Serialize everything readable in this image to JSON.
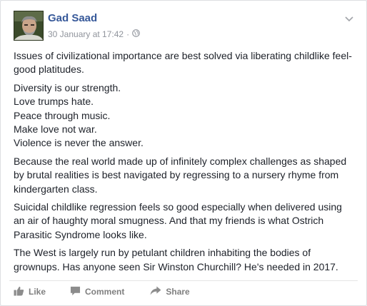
{
  "post": {
    "author": "Gad Saad",
    "timestamp": "30 January at 17:42",
    "separator": "·",
    "paragraphs": [
      "Issues of civilizational importance are best solved via liberating childlike feel-good platitudes.",
      [
        "Diversity is our strength.",
        "Love trumps hate.",
        "Peace through music.",
        "Make love not war.",
        "Violence is never the answer."
      ],
      "Because the real world made up of infinitely complex challenges as shaped by brutal realities is best navigated by regressing to a nursery rhyme from kindergarten class.",
      "Suicidal childlike regression feels so good especially when delivered using an air of haughty moral smugness. And that my friends is what Ostrich Parasitic Syndrome looks like.",
      "The West is largely run by petulant children inhabiting the bodies of grownups. Has anyone seen Sir Winston Churchill? He's needed in 2017."
    ]
  },
  "actions": {
    "like_label": "Like",
    "comment_label": "Comment",
    "share_label": "Share"
  },
  "icons": {
    "privacy": "globe-icon",
    "menu": "chevron-down-icon",
    "like": "thumbs-up-icon",
    "comment": "comment-bubble-icon",
    "share": "share-arrow-icon"
  },
  "colors": {
    "author_link": "#365899",
    "meta_text": "#90949c",
    "body_text": "#1d2129",
    "action_text": "#7f7f7f"
  }
}
